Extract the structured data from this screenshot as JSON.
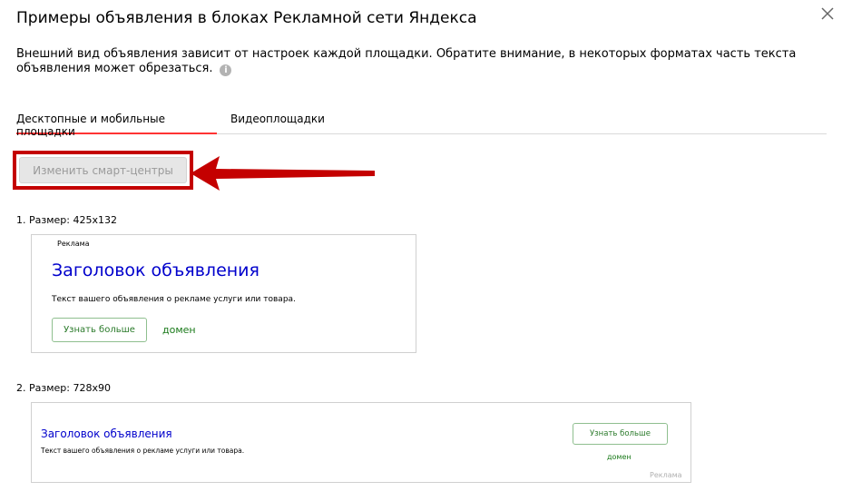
{
  "dialog": {
    "title": "Примеры объявления в блоках Рекламной сети Яндекса",
    "description": "Внешний вид объявления зависит от настроек каждой площадки. Обратите внимание, в некоторых форматах часть текста объявления может обрезаться."
  },
  "tabs": [
    {
      "label": "Десктопные и мобильные площадки",
      "active": true
    },
    {
      "label": "Видеоплощадки",
      "active": false
    }
  ],
  "actions": {
    "change_smart_centers": "Изменить смарт-центры"
  },
  "examples": [
    {
      "size_label": "1. Размер: 425x132",
      "ad_tag": "Реклама",
      "headline": "Заголовок объявления",
      "text": "Текст вашего объявления о рекламе услуги или товара.",
      "button": "Узнать больше",
      "domain": "домен"
    },
    {
      "size_label": "2. Размер: 728x90",
      "ad_tag": "Реклама",
      "headline": "Заголовок объявления",
      "text": "Текст вашего объявления о рекламе услуги или товара.",
      "button": "Узнать больше",
      "domain": "домен"
    }
  ],
  "colors": {
    "accent_tab": "#ff3333",
    "highlight": "#c40000",
    "headline": "#0000cc",
    "domain": "#1a7a1a"
  },
  "icons": [
    "close-icon",
    "info-icon",
    "annotation-arrow"
  ]
}
